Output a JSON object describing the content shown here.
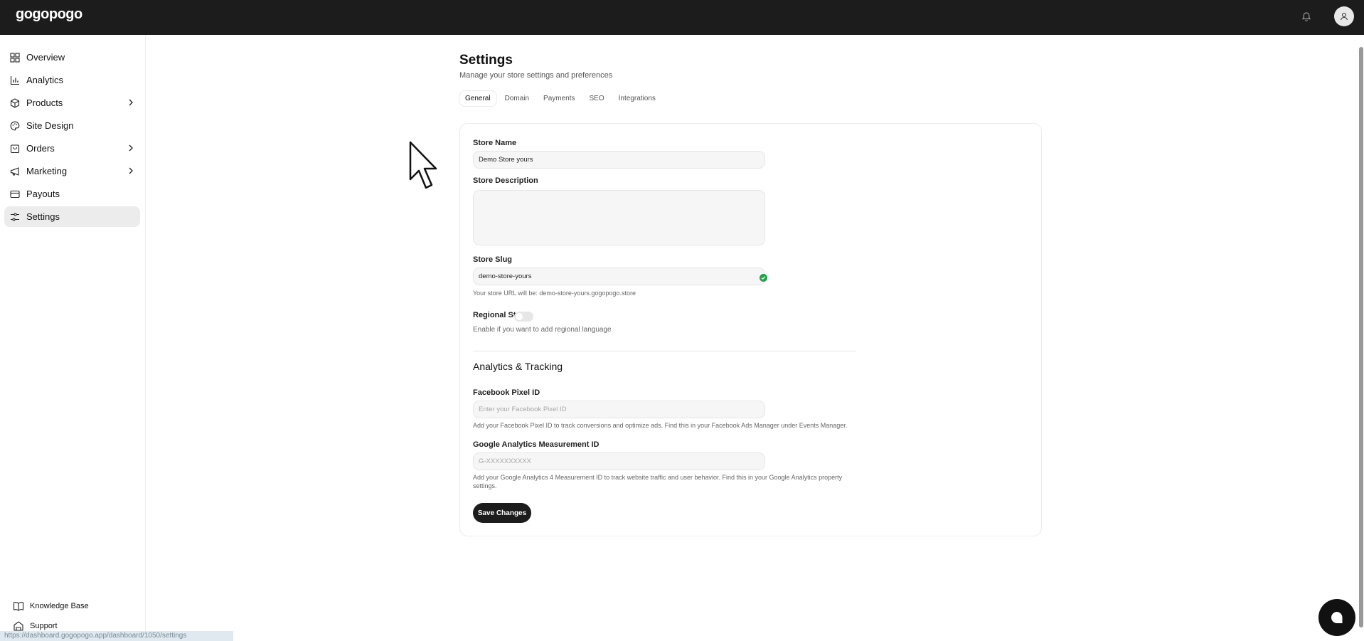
{
  "app": {
    "logo": "gogopogo"
  },
  "sidebar": {
    "items": [
      {
        "label": "Overview",
        "icon": "grid-icon"
      },
      {
        "label": "Analytics",
        "icon": "bar-chart-icon"
      },
      {
        "label": "Products",
        "icon": "box-icon",
        "expandable": true
      },
      {
        "label": "Site Design",
        "icon": "palette-icon"
      },
      {
        "label": "Orders",
        "icon": "shopping-bag-icon",
        "expandable": true
      },
      {
        "label": "Marketing",
        "icon": "megaphone-icon",
        "expandable": true
      },
      {
        "label": "Payouts",
        "icon": "card-icon"
      },
      {
        "label": "Settings",
        "icon": "sliders-icon",
        "active": true
      }
    ],
    "bottom": [
      {
        "label": "Knowledge Base",
        "icon": "book-icon"
      },
      {
        "label": "Support",
        "icon": "support-icon"
      }
    ]
  },
  "statusbar": {
    "url": "https://dashboard.gogopogo.app/dashboard/1050/settings"
  },
  "page": {
    "title": "Settings",
    "subtitle": "Manage your store settings and preferences",
    "tabs": [
      {
        "label": "General",
        "active": true
      },
      {
        "label": "Domain"
      },
      {
        "label": "Payments"
      },
      {
        "label": "SEO"
      },
      {
        "label": "Integrations"
      }
    ]
  },
  "form": {
    "store_name": {
      "label": "Store Name",
      "value": "Demo Store yours"
    },
    "store_description": {
      "label": "Store Description",
      "value": ""
    },
    "store_slug": {
      "label": "Store Slug",
      "value": "demo-store-yours",
      "hint": "Your store URL will be: demo-store-yours.gogopogo.store"
    },
    "regional_store": {
      "label": "Regional Store",
      "enabled": false,
      "hint": "Enable if you want to add regional language"
    },
    "analytics_section": "Analytics & Tracking",
    "facebook_pixel": {
      "label": "Facebook Pixel ID",
      "placeholder": "Enter your Facebook Pixel ID",
      "hint": "Add your Facebook Pixel ID to track conversions and optimize ads. Find this in your Facebook Ads Manager under Events Manager."
    },
    "google_analytics": {
      "label": "Google Analytics Measurement ID",
      "placeholder": "G-XXXXXXXXXX",
      "hint_line1": "Add your Google Analytics 4 Measurement ID to track website traffic and user behavior. Find this in your Google Analytics property",
      "hint_line2": "settings."
    },
    "save_label": "Save Changes"
  },
  "colors": {
    "topbar": "#1c1c1c",
    "active_nav": "#ececec",
    "success": "#22a34a",
    "primary_button": "#1c1c1c"
  }
}
